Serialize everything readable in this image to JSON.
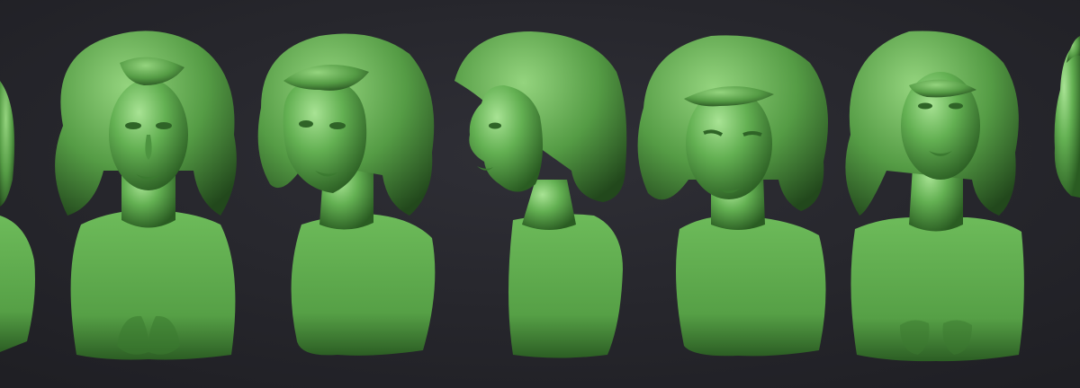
{
  "scene": {
    "description_free": true,
    "background_color": "#27272d",
    "material_color": "#5fa94f",
    "material_highlight": "#9fd98a",
    "material_shadow": "#1f4a1a",
    "views": [
      {
        "name": "bust-partial-left",
        "angle": "back-three-quarter"
      },
      {
        "name": "bust-front",
        "angle": "front"
      },
      {
        "name": "bust-three-quarter",
        "angle": "three-quarter-left"
      },
      {
        "name": "bust-profile",
        "angle": "profile-left"
      },
      {
        "name": "bust-downward",
        "angle": "front-tilted-down"
      },
      {
        "name": "bust-upward",
        "angle": "front-tilted-up"
      },
      {
        "name": "bust-partial-right",
        "angle": "profile-right"
      }
    ]
  }
}
